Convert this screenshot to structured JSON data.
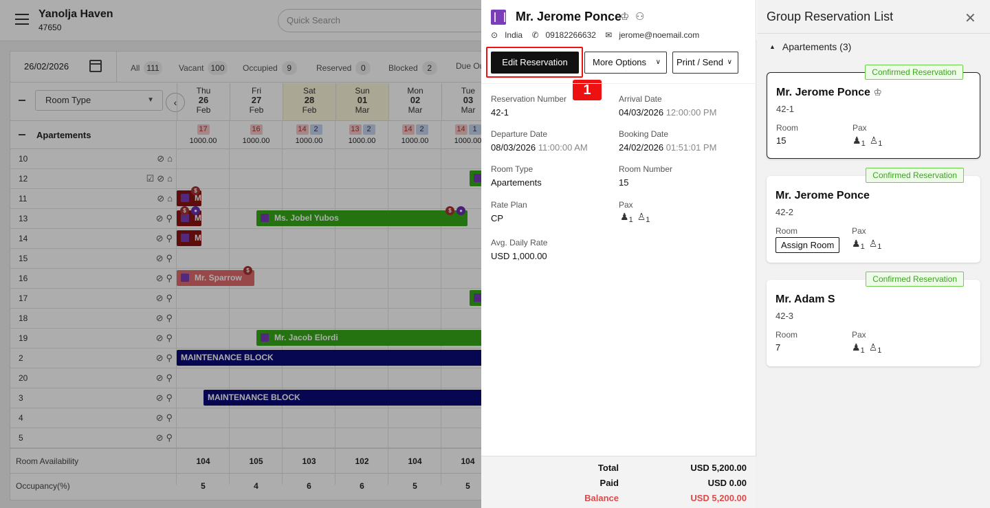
{
  "header": {
    "property_name": "Yanolja Haven",
    "property_code": "47650",
    "search_placeholder": "Quick Search"
  },
  "calendar": {
    "date": "26/02/2026",
    "filters": [
      {
        "label": "All",
        "count": "111"
      },
      {
        "label": "Vacant",
        "count": "100"
      },
      {
        "label": "Occupied",
        "count": "9"
      },
      {
        "label": "Reserved",
        "count": "0"
      },
      {
        "label": "Blocked",
        "count": "2"
      },
      {
        "label": "Due Ou",
        "count": ""
      }
    ],
    "room_type_select": "Room Type",
    "days": [
      {
        "dow": "Thu",
        "num": "26",
        "mon": "Feb",
        "weekend": false,
        "red": "17",
        "blue": "",
        "price": "1000.00"
      },
      {
        "dow": "Fri",
        "num": "27",
        "mon": "Feb",
        "weekend": false,
        "red": "16",
        "blue": "",
        "price": "1000.00"
      },
      {
        "dow": "Sat",
        "num": "28",
        "mon": "Feb",
        "weekend": true,
        "red": "14",
        "blue": "2",
        "price": "1000.00"
      },
      {
        "dow": "Sun",
        "num": "01",
        "mon": "Mar",
        "weekend": true,
        "red": "13",
        "blue": "2",
        "price": "1000.00"
      },
      {
        "dow": "Mon",
        "num": "02",
        "mon": "Mar",
        "weekend": false,
        "red": "14",
        "blue": "2",
        "price": "1000.00"
      },
      {
        "dow": "Tue",
        "num": "03",
        "mon": "Mar",
        "weekend": false,
        "red": "14",
        "blue": "1",
        "price": "1000.00"
      }
    ],
    "group_name": "Apartements",
    "rooms": [
      "10",
      "12",
      "11",
      "13",
      "14",
      "15",
      "16",
      "17",
      "18",
      "19",
      "2",
      "20",
      "3",
      "4",
      "5"
    ],
    "bookings": {
      "jobel": "Ms. Jobel Yubos",
      "sparrow": "Mr. Sparrow",
      "jacob": "Mr. Jacob Elordi",
      "m": "M",
      "maint1": "MAINTENANCE BLOCK",
      "maint2": "MAINTENANCE BLOCK",
      "dot_s": "$",
      "dot_p": "●"
    },
    "footer": {
      "availability_label": "Room Availability",
      "availability": [
        "104",
        "105",
        "103",
        "102",
        "104",
        "104"
      ],
      "occupancy_label": "Occupancy(%)",
      "occupancy": [
        "5",
        "4",
        "6",
        "6",
        "5",
        "5"
      ]
    }
  },
  "reservation": {
    "guest_name": "Mr. Jerome Ponce",
    "country": "India",
    "phone": "09182266632",
    "email": "jerome@noemail.com",
    "edit_label": "Edit Reservation",
    "more_label": "More Options",
    "print_label": "Print / Send",
    "step_badge": "1",
    "fields": {
      "reservation_number_label": "Reservation Number",
      "reservation_number": "42-1",
      "arrival_label": "Arrival Date",
      "arrival_date": "04/03/2026",
      "arrival_time": "12:00:00 PM",
      "departure_label": "Departure Date",
      "departure_date": "08/03/2026",
      "departure_time": "11:00:00 AM",
      "booking_label": "Booking Date",
      "booking_date": "24/02/2026",
      "booking_time": "01:51:01 PM",
      "room_type_label": "Room Type",
      "room_type": "Apartements",
      "room_number_label": "Room Number",
      "room_number": "15",
      "rate_plan_label": "Rate Plan",
      "rate_plan": "CP",
      "pax_label": "Pax",
      "adults": "1",
      "children": "1",
      "avg_rate_label": "Avg. Daily Rate",
      "avg_rate": "USD 1,000.00"
    },
    "totals": {
      "total_label": "Total",
      "total": "USD 5,200.00",
      "paid_label": "Paid",
      "paid": "USD 0.00",
      "balance_label": "Balance",
      "balance": "USD 5,200.00"
    }
  },
  "group_list": {
    "title": "Group Reservation List",
    "section": "Apartements (3)",
    "room_label": "Room",
    "pax_label": "Pax",
    "cards": [
      {
        "status": "Confirmed Reservation",
        "name": "Mr. Jerome Ponce",
        "res": "42-1",
        "room": "15",
        "adults": "1",
        "children": "1"
      },
      {
        "status": "Confirmed Reservation",
        "name": "Mr. Jerome Ponce",
        "res": "42-2",
        "room": "",
        "assign": "Assign Room",
        "adults": "1",
        "children": "1"
      },
      {
        "status": "Confirmed Reservation",
        "name": "Mr. Adam S",
        "res": "42-3",
        "room": "7",
        "adults": "1",
        "children": "1"
      }
    ]
  },
  "colors": {
    "accent_red": "#e11111",
    "booking_green": "#35a818",
    "maintenance_navy": "#0a0a78",
    "confirmed_green": "#3aa51c",
    "balance_red": "#e04848"
  }
}
